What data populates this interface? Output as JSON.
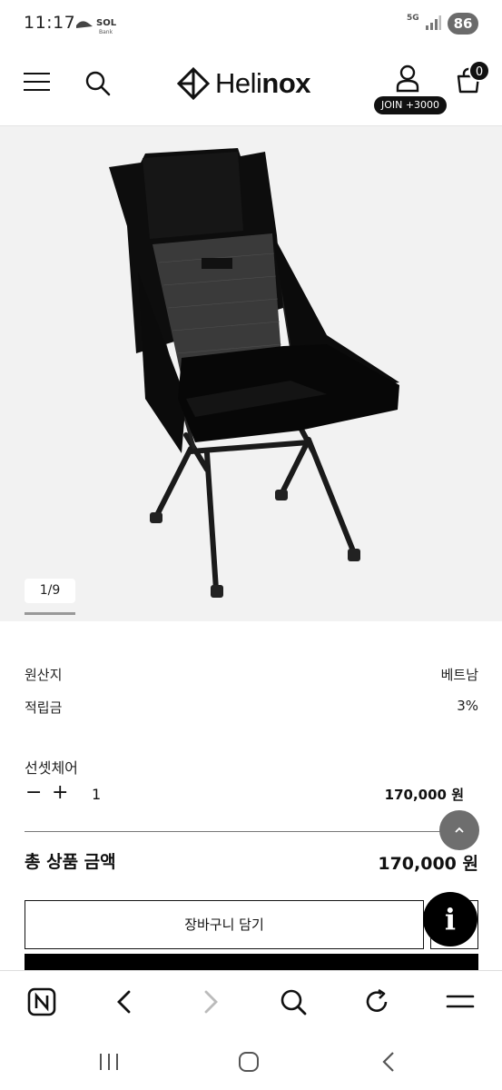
{
  "status_bar": {
    "time": "11:17",
    "sol_label": "SOL",
    "sol_sub": "Bank",
    "network": "5G",
    "battery": "86"
  },
  "header": {
    "logo_text_light": "Heli",
    "logo_text_bold": "nox",
    "join_badge": "JOIN +3000",
    "cart_count": "0"
  },
  "gallery": {
    "page_indicator": "1/9"
  },
  "product_info": {
    "origin_label": "원산지",
    "origin_value": "베트남",
    "points_label": "적립금",
    "points_value": "3%"
  },
  "option": {
    "name": "선셋체어",
    "minus": "−",
    "plus": "+",
    "quantity": "1",
    "price": "170,000 원"
  },
  "total": {
    "label": "총 상품 금액",
    "price": "170,000 원"
  },
  "actions": {
    "add_to_cart": "장바구니 담기",
    "info_icon": "i",
    "scroll_top": "^"
  }
}
